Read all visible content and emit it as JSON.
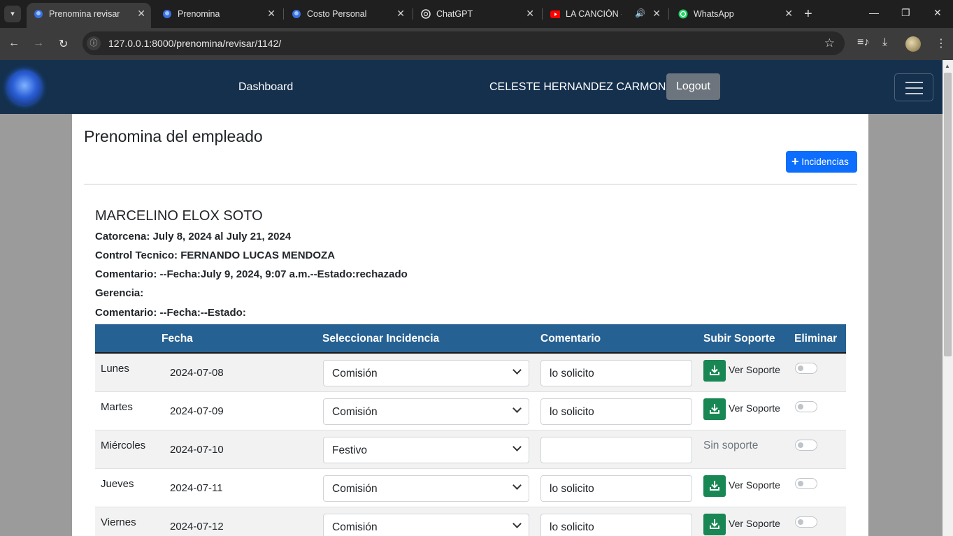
{
  "browser": {
    "tabs": [
      {
        "title": "Prenomina revisar",
        "active": true
      },
      {
        "title": "Prenomina",
        "active": false
      },
      {
        "title": "Costo Personal",
        "active": false
      },
      {
        "title": "ChatGPT",
        "active": false
      },
      {
        "title": "LA CANCIÓN - Yo",
        "active": false
      },
      {
        "title": "WhatsApp",
        "active": false
      }
    ],
    "url": "127.0.0.1:8000/prenomina/revisar/1142/"
  },
  "navbar": {
    "dashboard_label": "Dashboard",
    "user_name": "CELESTE HERNANDEZ CARMONA",
    "logout_label": "Logout"
  },
  "page": {
    "title": "Prenomina del empleado",
    "incidencias_label": "Incidencias"
  },
  "employee": {
    "name": "MARCELINO ELOX SOTO",
    "catorcena": "Catorcena: July 8, 2024 al July 21, 2024",
    "control": "Control Tecnico: FERNANDO LUCAS MENDOZA",
    "comentario1": "Comentario: --Fecha:July 9, 2024, 9:07 a.m.--Estado:rechazado",
    "gerencia": "Gerencia:",
    "comentario2": "Comentario: --Fecha:--Estado:"
  },
  "table": {
    "headers": {
      "fecha": "Fecha",
      "incidencia": "Seleccionar Incidencia",
      "comentario": "Comentario",
      "soporte": "Subir Soporte",
      "eliminar": "Eliminar"
    },
    "ver_soporte_label": "Ver Soporte",
    "sin_soporte_label": "Sin soporte",
    "rows": [
      {
        "day": "Lunes",
        "date": "2024-07-08",
        "incidencia": "Comisión",
        "comentario": "lo solicito"
      },
      {
        "day": "Martes",
        "date": "2024-07-09",
        "incidencia": "Comisión",
        "comentario": "lo solicito"
      },
      {
        "day": "Miércoles",
        "date": "2024-07-10",
        "incidencia": "Festivo",
        "comentario": ""
      },
      {
        "day": "Jueves",
        "date": "2024-07-11",
        "incidencia": "Comisión",
        "comentario": "lo solicito"
      },
      {
        "day": "Viernes",
        "date": "2024-07-12",
        "incidencia": "Comisión",
        "comentario": "lo solicito"
      }
    ]
  },
  "colors": {
    "navbar_bg": "#14304d",
    "table_header_bg": "#266193",
    "primary_button": "#0d6efd",
    "download_button": "#198754",
    "logout_button": "#6c757d"
  },
  "icons": {
    "tab_menu": "chevron-down-icon",
    "back": "back-arrow-icon",
    "forward": "forward-arrow-icon",
    "reload": "reload-icon",
    "site_info": "site-info-icon",
    "bookmark": "star-icon",
    "media": "media-controls-icon",
    "downloads": "download-icon",
    "menu": "kebab-menu-icon",
    "download_support": "download-icon",
    "add": "plus-icon",
    "hamburger": "hamburger-menu-icon"
  }
}
